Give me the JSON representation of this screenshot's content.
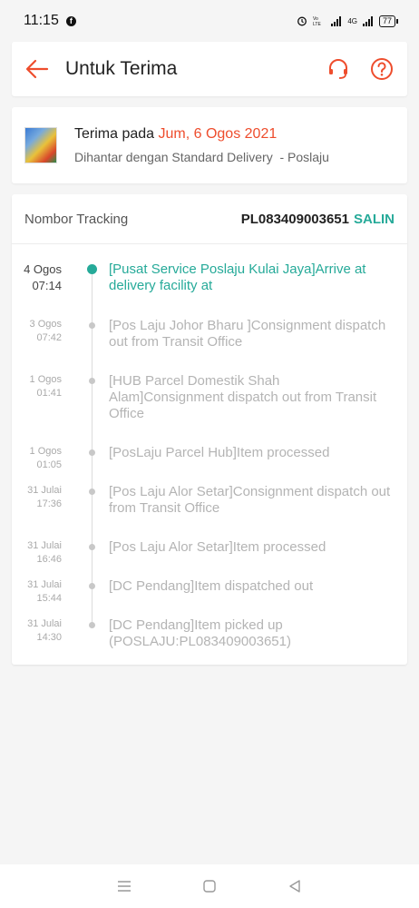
{
  "status_bar": {
    "time": "11:15",
    "battery": "77",
    "network": "4G"
  },
  "header": {
    "title": "Untuk Terima",
    "back_icon": "arrow-left-icon",
    "support_icon": "headset-icon",
    "help_icon": "question-icon",
    "accent": "#ee4d2d"
  },
  "delivery": {
    "receive_label": "Terima pada ",
    "receive_date": "Jum, 6 Ogos 2021",
    "shipping_text": "Dihantar dengan Standard Delivery  - Poslaju"
  },
  "tracking": {
    "label": "Nombor Tracking",
    "number": "PL083409003651",
    "copy_label": "SALIN",
    "accent": "#26aa99",
    "events": [
      {
        "date": "4 Ogos",
        "time": "07:14",
        "text": "[Pusat Service Poslaju Kulai Jaya]Arrive at delivery facility at"
      },
      {
        "date": "3 Ogos",
        "time": "07:42",
        "text": "[Pos Laju Johor Bharu ]Consignment dispatch out from Transit Office"
      },
      {
        "date": "1 Ogos",
        "time": "01:41",
        "text": "[HUB Parcel Domestik Shah Alam]Consignment dispatch out from Transit Office"
      },
      {
        "date": "1 Ogos",
        "time": "01:05",
        "text": "[PosLaju Parcel Hub]Item processed"
      },
      {
        "date": "31 Julai",
        "time": "17:36",
        "text": "[Pos Laju Alor Setar]Consignment dispatch out from Transit Office"
      },
      {
        "date": "31 Julai",
        "time": "16:46",
        "text": "[Pos Laju Alor Setar]Item processed"
      },
      {
        "date": "31 Julai",
        "time": "15:44",
        "text": "[DC Pendang]Item dispatched out"
      },
      {
        "date": "31 Julai",
        "time": "14:30",
        "text": "[DC Pendang]Item picked up (POSLAJU:PL083409003651)"
      }
    ]
  },
  "nav": {
    "menu_icon": "menu-icon",
    "home_icon": "home-icon",
    "back_icon": "back-triangle-icon"
  }
}
